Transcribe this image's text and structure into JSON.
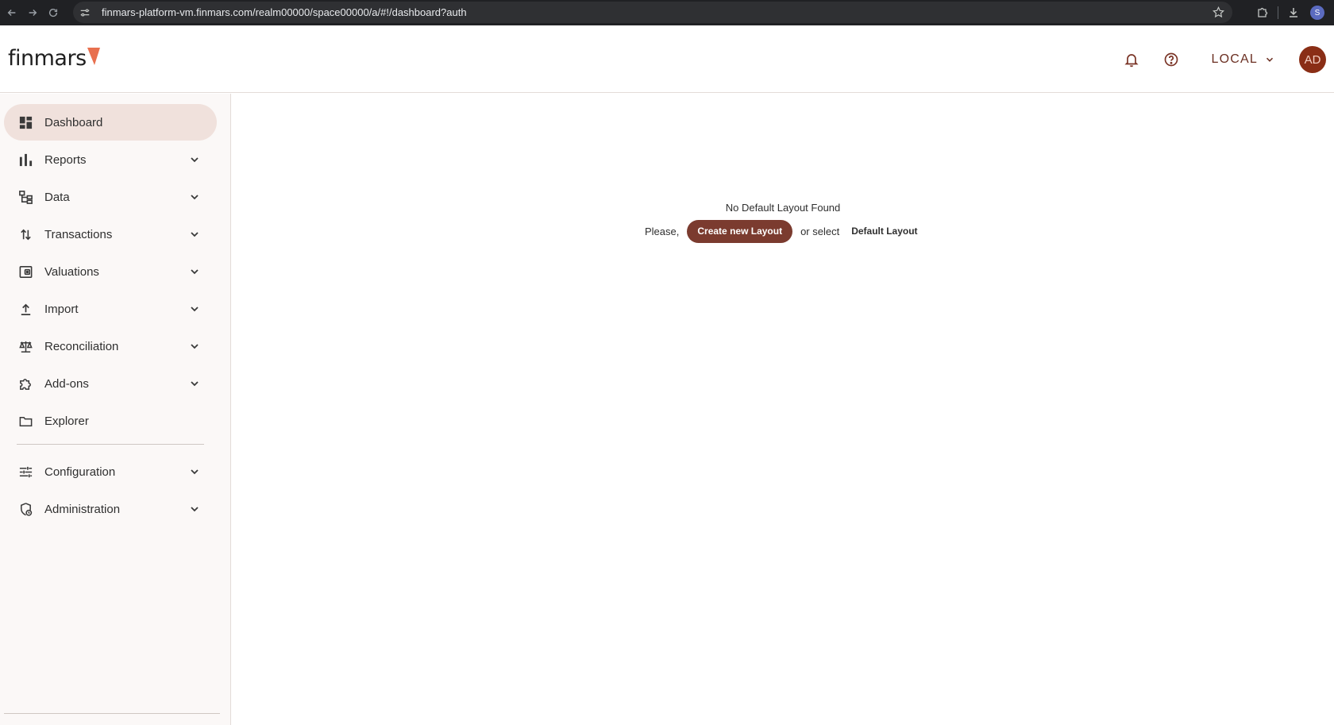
{
  "browser": {
    "url": "finmars-platform-vm.finmars.com/realm00000/space00000/a/#!/dashboard?auth",
    "profile_initial": "S"
  },
  "header": {
    "logo_text": "finmars",
    "realm_label": "LOCAL",
    "avatar_initials": "AD",
    "accent_color": "#7b3b2f",
    "logo_mark_color": "#e8704f"
  },
  "sidebar": {
    "items": [
      {
        "label": "Dashboard",
        "icon": "dashboard-icon",
        "active": true,
        "expandable": false
      },
      {
        "label": "Reports",
        "icon": "bar-chart-icon",
        "expandable": true
      },
      {
        "label": "Data",
        "icon": "tree-icon",
        "expandable": true
      },
      {
        "label": "Transactions",
        "icon": "swap-vertical-icon",
        "expandable": true
      },
      {
        "label": "Valuations",
        "icon": "wallet-icon",
        "expandable": true
      },
      {
        "label": "Import",
        "icon": "upload-icon",
        "expandable": true
      },
      {
        "label": "Reconciliation",
        "icon": "balance-scale-icon",
        "expandable": true
      },
      {
        "label": "Add-ons",
        "icon": "puzzle-icon",
        "expandable": true
      },
      {
        "label": "Explorer",
        "icon": "folder-icon",
        "expandable": false
      },
      {
        "label": "Configuration",
        "icon": "tune-icon",
        "expandable": true
      },
      {
        "label": "Administration",
        "icon": "admin-shield-icon",
        "expandable": true
      }
    ]
  },
  "main": {
    "empty_title": "No Default Layout Found",
    "prefix": "Please,",
    "create_button": "Create new Layout",
    "middle_text": "or select",
    "default_layout_button": "Default Layout"
  }
}
